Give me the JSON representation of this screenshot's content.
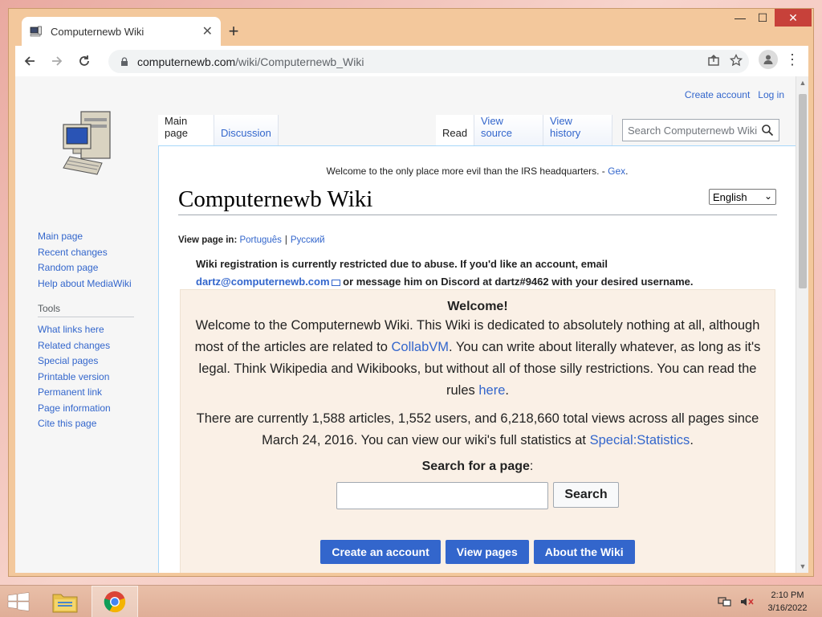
{
  "browser": {
    "tab_title": "Computernewb Wiki",
    "url_host": "computernewb.com",
    "url_path": "/wiki/Computernewb_Wiki"
  },
  "page": {
    "personal": {
      "create_account": "Create account",
      "log_in": "Log in"
    },
    "tabs": {
      "main_page": "Main page",
      "discussion": "Discussion",
      "read": "Read",
      "view_source": "View source",
      "view_history": "View history"
    },
    "search_placeholder": "Search Computernewb Wiki",
    "sitenotice": {
      "text": "Welcome to the only place more evil than the IRS headquarters. - ",
      "link": "Gex",
      "end": "."
    },
    "title": "Computernewb Wiki",
    "language": "English",
    "view_in": {
      "label": "View page in:",
      "lang1": "Português",
      "sep": "|",
      "lang2": "Русский"
    },
    "restricted": {
      "line1": "Wiki registration is currently restricted due to abuse. If you'd like an account, email",
      "email": "dartz@computernewb.com",
      "line2": " or message him on Discord at dartz#9462 with your desired username."
    },
    "welcome": {
      "heading": "Welcome!",
      "p1_a": "Welcome to the Computernewb Wiki. This Wiki is dedicated to absolutely nothing at all, although most of the articles are related to ",
      "p1_link1": "CollabVM",
      "p1_b": ". You can write about literally whatever, as long as it's legal. Think Wikipedia and Wikibooks, but without all of those silly restrictions. You can read the rules ",
      "p1_link2": "here",
      "p1_c": ".",
      "p2_a": "There are currently 1,588 articles, 1,552 users, and 6,218,660 total views across all pages since March 24, 2016. You can view our wiki's full statistics at ",
      "p2_link": "Special:Statistics",
      "p2_b": ".",
      "search_heading": "Search for a page",
      "search_colon": ":",
      "search_button": "Search",
      "buttons": {
        "create": "Create an account",
        "view": "View pages",
        "about": "About the Wiki"
      }
    }
  },
  "sidebar": {
    "nav": [
      "Main page",
      "Recent changes",
      "Random page",
      "Help about MediaWiki"
    ],
    "tools_heading": "Tools",
    "tools": [
      "What links here",
      "Related changes",
      "Special pages",
      "Printable version",
      "Permanent link",
      "Page information",
      "Cite this page"
    ]
  },
  "taskbar": {
    "time": "2:10 PM",
    "date": "3/16/2022"
  }
}
